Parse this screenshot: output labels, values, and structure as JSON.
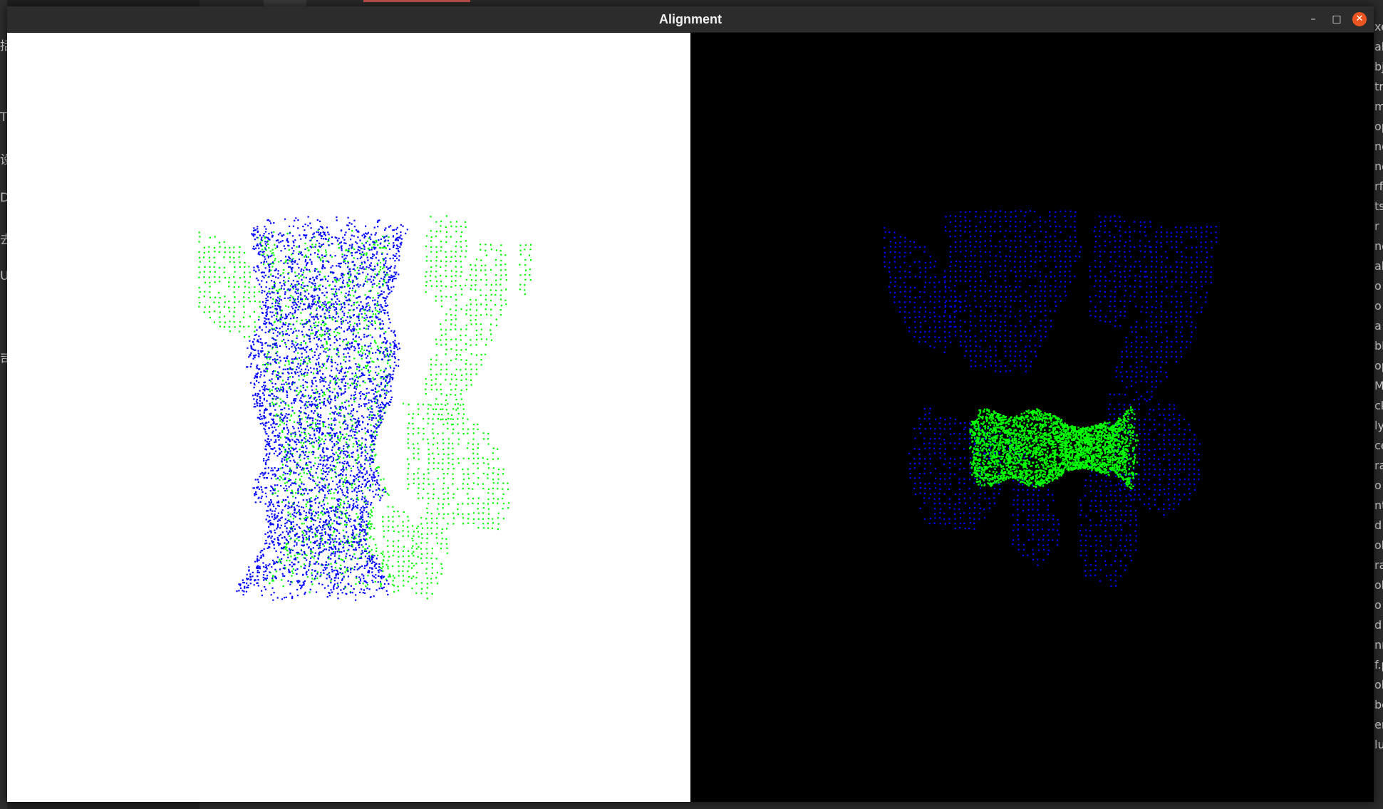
{
  "window": {
    "title": "Alignment",
    "controls": {
      "minimize": "–",
      "maximize": "□",
      "close": "✕"
    }
  },
  "viewports": {
    "before": {
      "background": "#ffffff",
      "source_color": "#0000ff",
      "target_color": "#00ff00"
    },
    "after": {
      "background": "#000000",
      "source_color": "#0000ff",
      "target_color": "#00ff00"
    }
  },
  "background_left_glyphs": [
    "括",
    "TH",
    "设",
    "D",
    "去",
    "UC",
    "司"
  ],
  "background_right_glyphs": [
    "xe",
    "ab",
    "bj",
    "tr",
    "m",
    "op",
    "ng",
    "ng",
    "rf",
    "ts",
    "r",
    "nd",
    "ab",
    "o",
    "o",
    "a",
    "bl",
    "op",
    "Ma",
    "ck",
    "ly",
    "ce",
    "ra",
    "o",
    "nt",
    "d",
    "ok",
    "ra",
    "ok",
    "o",
    "d",
    "nr",
    "f.p",
    "ok",
    "bo",
    "er",
    "lu"
  ]
}
